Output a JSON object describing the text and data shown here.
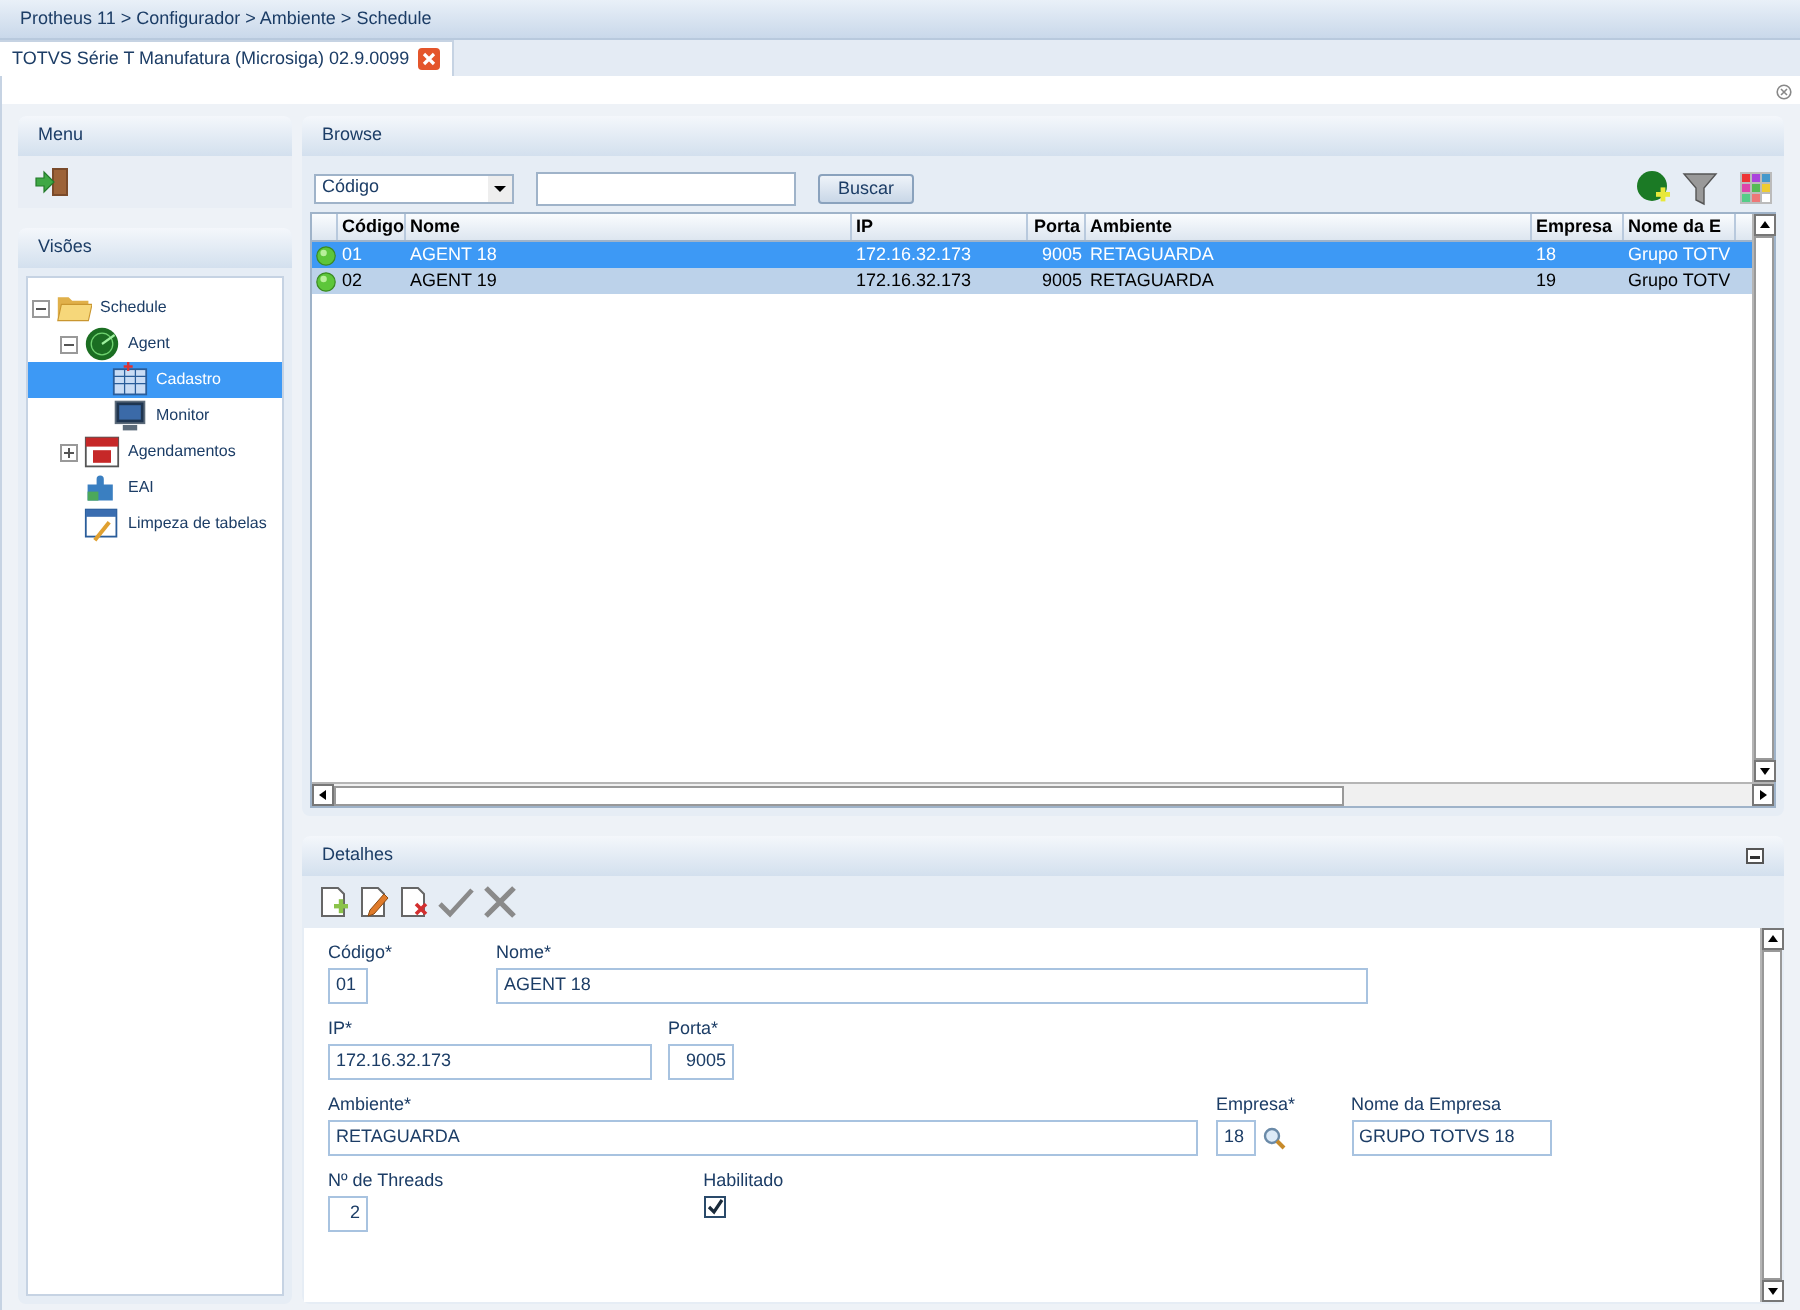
{
  "breadcrumb": "Protheus 11 > Configurador > Ambiente > Schedule",
  "tabs": [
    {
      "label": "TOTVS Série T Manufatura (Microsiga) 02.9.0099",
      "selected": true
    }
  ],
  "menu": {
    "title": "Menu"
  },
  "views": {
    "title": "Visões",
    "tree": [
      {
        "label": "Schedule",
        "kind": "folder",
        "expanded": true,
        "selected": false,
        "children": [
          {
            "label": "Agent",
            "kind": "radar",
            "expanded": true,
            "selected": false,
            "children": [
              {
                "label": "Cadastro",
                "kind": "grid",
                "selected": true
              },
              {
                "label": "Monitor",
                "kind": "monitor",
                "selected": false
              }
            ]
          },
          {
            "label": "Agendamentos",
            "kind": "calendar",
            "expanded": false,
            "selected": false
          },
          {
            "label": "EAI",
            "kind": "puzzle",
            "selected": false
          },
          {
            "label": "Limpeza de tabelas",
            "kind": "broom",
            "selected": false
          }
        ]
      }
    ]
  },
  "browse": {
    "title": "Browse",
    "search_by": "Código",
    "search_button": "Buscar",
    "columns": [
      "Código",
      "Nome",
      "IP",
      "Porta",
      "Ambiente",
      "Empresa",
      "Nome da E"
    ],
    "rows": [
      {
        "selected": true,
        "cells": [
          "01",
          "AGENT 18",
          "172.16.32.173",
          "9005",
          "RETAGUARDA",
          "18",
          "Grupo TOTV"
        ]
      },
      {
        "selected": false,
        "cells": [
          "02",
          "AGENT 19",
          "172.16.32.173",
          "9005",
          "RETAGUARDA",
          "19",
          "Grupo TOTV"
        ]
      }
    ]
  },
  "details": {
    "title": "Detalhes",
    "rows": [
      [
        {
          "kind": "text",
          "label": "Código*",
          "value": "01"
        },
        {
          "kind": "text",
          "label": "Nome*",
          "value": "AGENT 18"
        }
      ],
      [
        {
          "kind": "text",
          "label": "IP*",
          "value": "172.16.32.173"
        },
        {
          "kind": "text",
          "label": "Porta*",
          "value": "9005"
        }
      ],
      [
        {
          "kind": "text",
          "label": "Ambiente*",
          "value": "RETAGUARDA"
        },
        {
          "kind": "lookup",
          "label": "Empresa*",
          "value": "18"
        },
        {
          "kind": "text",
          "label": "Nome da Empresa",
          "value": "GRUPO TOTVS 18"
        }
      ],
      [
        {
          "kind": "text",
          "label": "Nº de Threads",
          "value": "2"
        },
        {
          "kind": "checkbox",
          "label": "Habilitado",
          "checked": true
        }
      ]
    ]
  }
}
